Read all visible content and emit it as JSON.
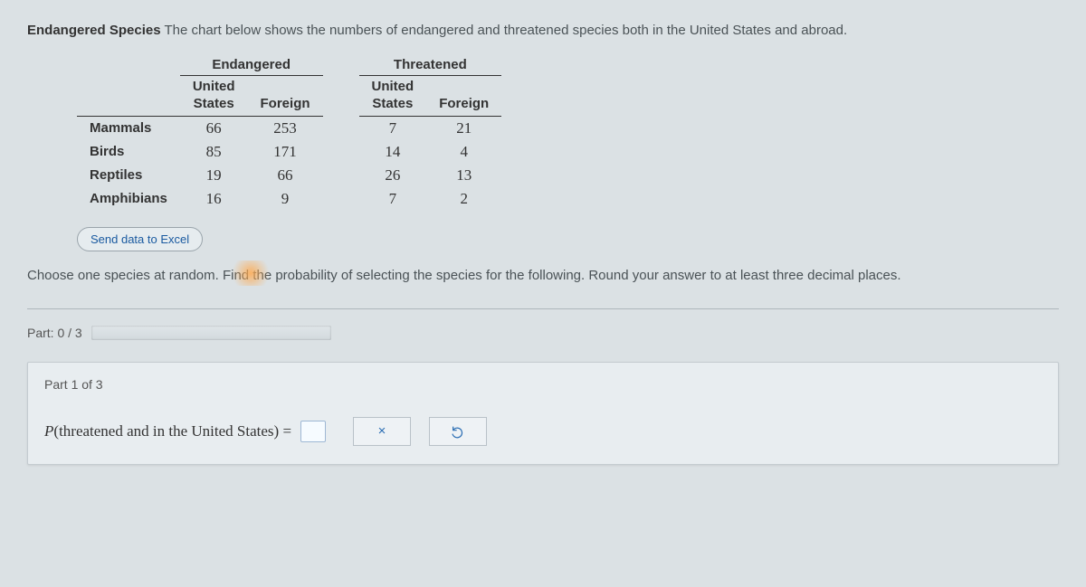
{
  "intro": {
    "headline": "Endangered Species",
    "text": "The chart below shows the numbers of endangered and threatened species both in the United States and abroad."
  },
  "chart_data": {
    "type": "table",
    "group_headers": [
      "Endangered",
      "Threatened"
    ],
    "sub_headers": [
      "United States",
      "Foreign",
      "United States",
      "Foreign"
    ],
    "rows": [
      {
        "label": "Mammals",
        "values": [
          66,
          253,
          7,
          21
        ]
      },
      {
        "label": "Birds",
        "values": [
          85,
          171,
          14,
          4
        ]
      },
      {
        "label": "Reptiles",
        "values": [
          19,
          66,
          26,
          13
        ]
      },
      {
        "label": "Amphibians",
        "values": [
          16,
          9,
          7,
          2
        ]
      }
    ]
  },
  "buttons": {
    "send_excel": "Send data to Excel"
  },
  "instruction": "Choose one species at random. Find the probability of selecting the species for the following. Round your answer to at least three decimal places.",
  "progress": {
    "label": "Part: 0 / 3"
  },
  "part1": {
    "title": "Part 1 of 3",
    "prob_prefix": "P",
    "prob_inner": "threatened and in the United States",
    "equals": "="
  },
  "icons": {
    "clear": "×",
    "reset": "↺"
  }
}
